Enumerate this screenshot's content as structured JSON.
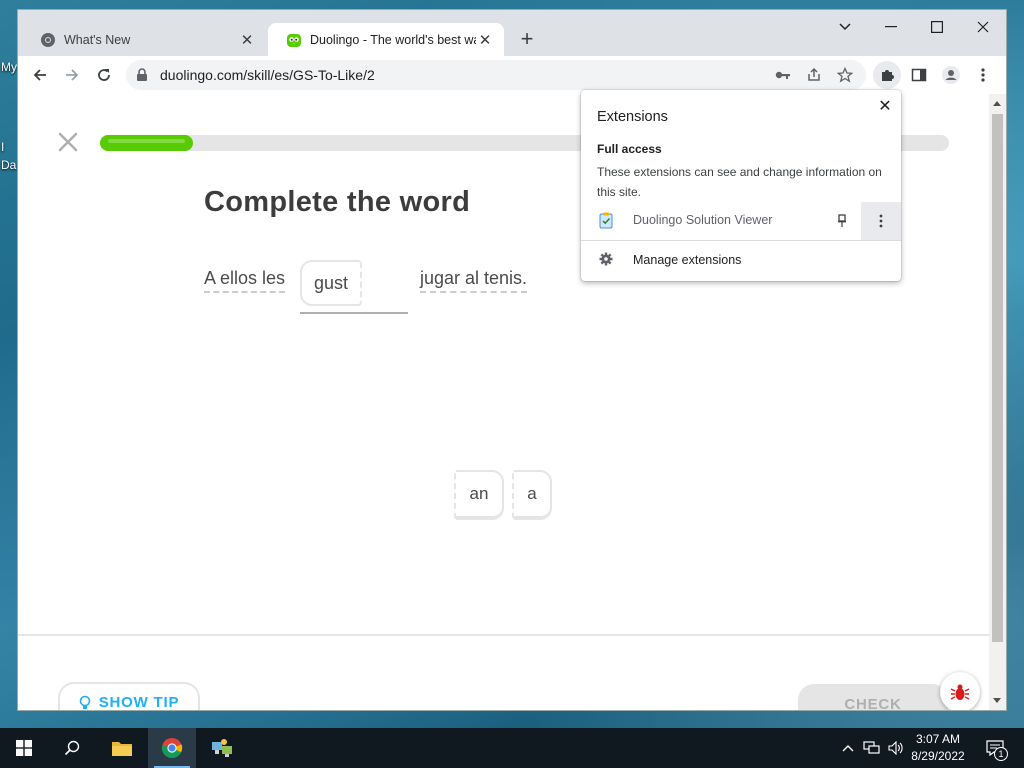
{
  "desktop": {
    "labels": [
      "My",
      "I",
      "Da"
    ]
  },
  "tabs": [
    {
      "title": "What's New",
      "icon": "chrome-icon",
      "active": false
    },
    {
      "title": "Duolingo - The world's best way",
      "icon": "duolingo-owl-icon",
      "active": true
    }
  ],
  "address_bar": {
    "url": "duolingo.com/skill/es/GS-To-Like/2"
  },
  "lesson": {
    "progress": 0.11,
    "title": "Complete the word",
    "sentence_before": "A ellos les",
    "partial_word": "gust",
    "sentence_after": "jugar al tenis.",
    "word_bank": [
      "an",
      "a"
    ],
    "show_tip_label": "SHOW TIP",
    "check_label": "CHECK"
  },
  "extensions_popup": {
    "title": "Extensions",
    "section_title": "Full access",
    "section_description": "These extensions can see and change information on this site.",
    "extension_name": "Duolingo Solution Viewer",
    "manage_label": "Manage extensions"
  },
  "taskbar": {
    "time": "3:07 AM",
    "date": "8/29/2022",
    "notification_count": "1"
  },
  "colors": {
    "progress_green": "#58cc02",
    "tip_blue": "#1cb0f6",
    "tab_strip": "#dee1e6",
    "taskbar": "#101820"
  }
}
